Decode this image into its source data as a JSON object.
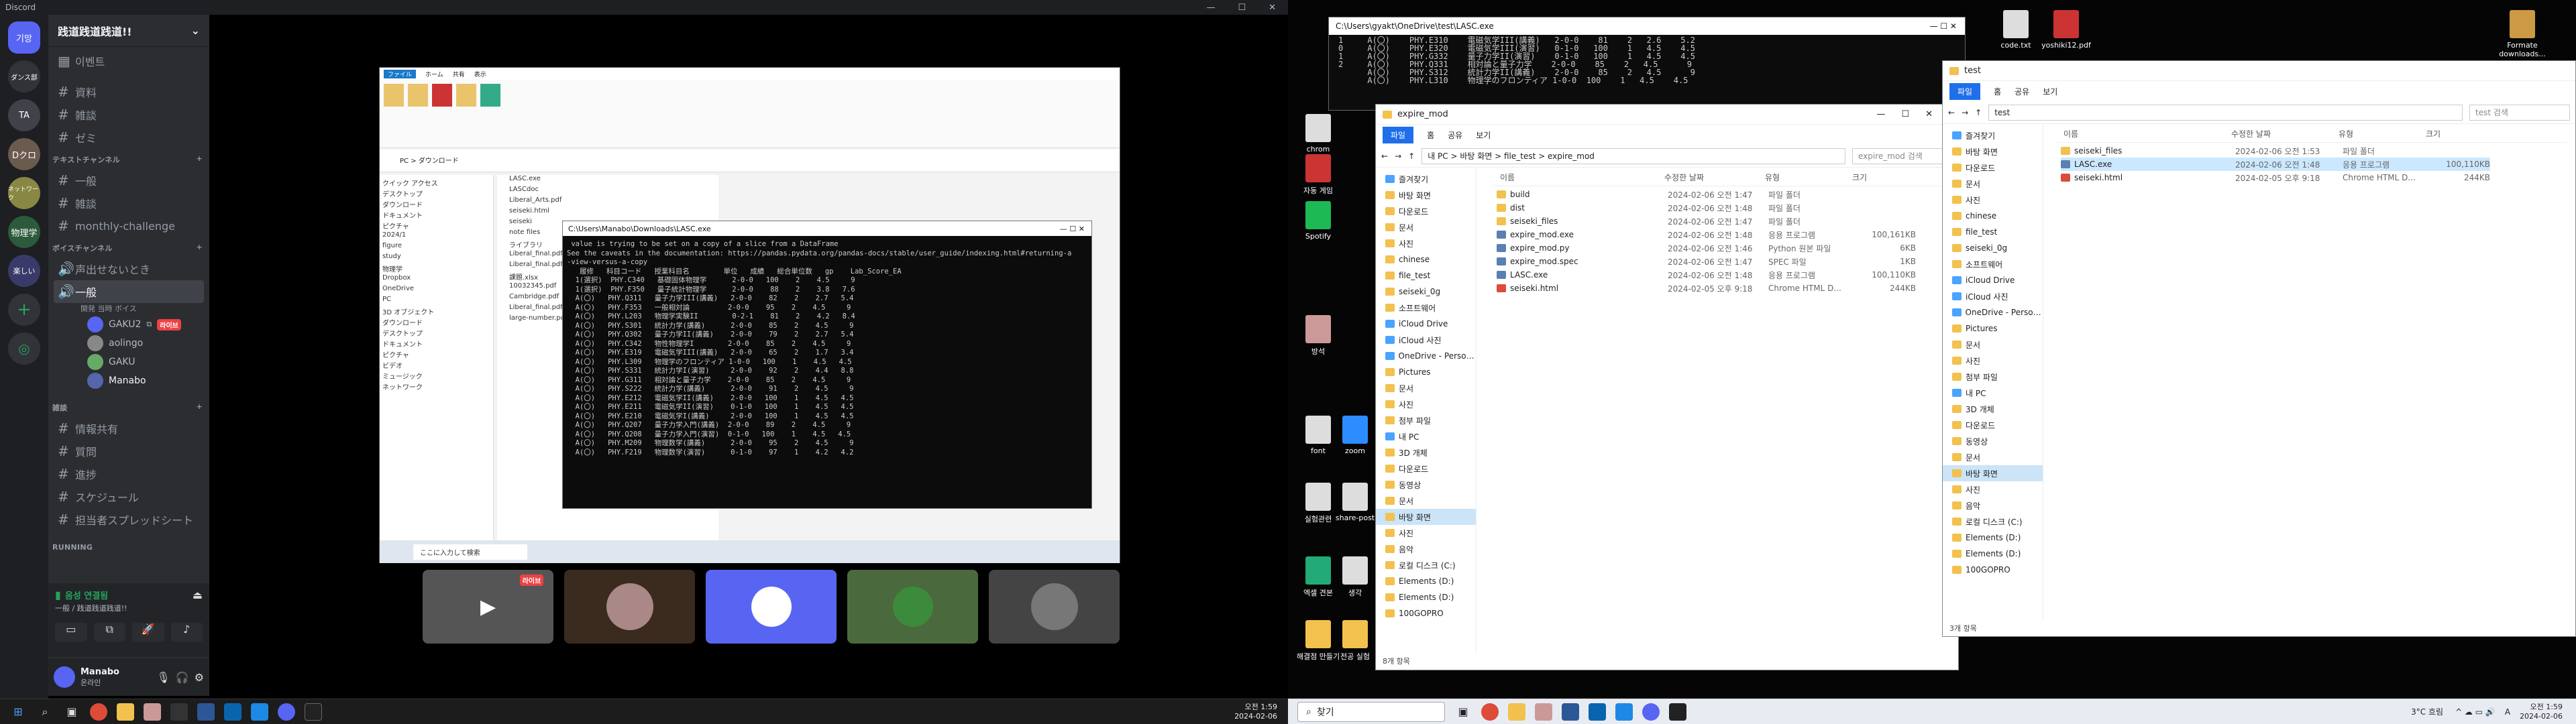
{
  "discord": {
    "app_title": "Discord",
    "server_name": "践道践道践道!!",
    "top_channels": [
      {
        "label": "이벤트"
      }
    ],
    "channels_a": [
      "資料",
      "雑談",
      "ゼミ"
    ],
    "cat_text": "テキストチャンネル",
    "channels_b": [
      "一般",
      "雑談",
      "monthly-challenge"
    ],
    "cat_voice": "ボイスチャンネル",
    "voice_channels": [
      "声出せないとき",
      "一般"
    ],
    "voice_sub": "開発 当時 ボイス",
    "voice_users": [
      {
        "name": "GAKU2",
        "live": "라이브"
      },
      {
        "name": "aolingo",
        "live": ""
      },
      {
        "name": "GAKU",
        "live": ""
      },
      {
        "name": "Manabo",
        "live": ""
      }
    ],
    "cat_misc": "雑談",
    "channels_c": [
      "情報共有",
      "質問",
      "進捗",
      "スケジュール",
      "担当者スプレッドシート"
    ],
    "cat_running": "RUNNING",
    "vc_status": "음성 연결됨",
    "vc_sub": "一般 / 践道践道践道!!",
    "user_name": "Manabo",
    "user_status": "온라인",
    "guild_labels": [
      "기망",
      "ダンス部",
      "TA",
      "Dクロ",
      "ネットワーク",
      "物理学",
      "楽しい"
    ],
    "tile_live": "라이브"
  },
  "stream": {
    "explorer_tabs": [
      "ファイル",
      "ホーム",
      "共有",
      "表示"
    ],
    "explorer_path": "PC > ダウンロード",
    "tree": [
      "クイック アクセス",
      "デスクトップ",
      "ダウンロード",
      "ドキュメント",
      "ピクチャ",
      "2024/1",
      "figure",
      "study",
      "物理学",
      "Dropbox",
      "OneDrive",
      "PC",
      "3D オブジェクト",
      "ダウンロード",
      "デスクトップ",
      "ドキュメント",
      "ピクチャ",
      "ビデオ",
      "ミュージック",
      "ネットワーク"
    ],
    "files": [
      "LASC.exe",
      "LASCdoc",
      "Liberal_Arts.pdf",
      "seiseki.html",
      "seiseki",
      "note files",
      "ライブラリ",
      "Liberal_final.pdf",
      "Liberal_final.pdf",
      "課題.xlsx",
      "10032345.pdf",
      "Cambridge.pdf",
      "Liberal_final.pdf",
      "large-number.pdf"
    ],
    "cmd_title": "C:\\Users\\Manabo\\Downloads\\LASC.exe",
    "cmd_lines": [
      " value is trying to be set on a copy of a slice from a DataFrame",
      "",
      "See the caveats in the documentation: https://pandas.pydata.org/pandas-docs/stable/user_guide/indexing.html#returning-a",
      "-view-versus-a-copy",
      "",
      "   履修   科目コード   授業科目名        単位   成績   総合単位数   gp    Lab_Score_EA",
      "  1(選択)  PHY.C340   基礎固体物理学      2-0-0   100    2    4.5     9",
      "  1(選択)  PHY.F350   量子統計物理学      2-0-0    88    2    3.8   7.6",
      "  A(〇)   PHY.Q311   量子力学III(講義)   2-0-0    82    2    2.7   5.4",
      "  A(〇)   PHY.F353   一般相対論         2-0-0    95    2    4.5     9",
      "  A(〇)   PHY.L203   物理学実験II        0-2-1    81    2    4.2   8.4",
      "  A(〇)   PHY.S301   統計力学(講義)      2-0-0    85    2    4.5     9",
      "  A(〇)   PHY.Q302   量子力学II(講義)    2-0-0    79    2    2.7   5.4",
      "  A(〇)   PHY.C342   物性物理学I        2-0-0    85    2    4.5     9",
      "  A(〇)   PHY.E319   電磁気学III(講義)   2-0-0    65    2    1.7   3.4",
      "  A(〇)   PHY.L309   物理学のフロンティア 1-0-0   100    1    4.5   4.5",
      "  A(〇)   PHY.S331   統計力学I(演習)     2-0-0    92    2    4.4   8.8",
      "  A(〇)   PHY.G311   相対論と量子力学    2-0-0    85    2    4.5     9",
      "  A(〇)   PHY.S222   統計力学(講義)      2-0-0    91    2    4.5     9",
      "  A(〇)   PHY.E212   電磁気学II(講義)    2-0-0   100    1    4.5   4.5",
      "  A(〇)   PHY.E211   電磁気学II(演習)    0-1-0   100    1    4.5   4.5",
      "  A(〇)   PHY.E210   電磁気学I(講義)     2-0-0   100    1    4.5   4.5",
      "  A(〇)   PHY.Q207   量子力学入門(講義)  2-0-0    89    2    4.5     9",
      "  A(〇)   PHY.Q208   量子力学入門(演習)  0-1-0   100    1    4.5   4.5",
      "  A(〇)   PHY.M209   物理数学(講義)      2-0-0    95    2    4.5     9",
      "  A(〇)   PHY.F219   物理数学(演習)      0-1-0    97    1    4.2   4.2"
    ],
    "search_text": "ここに入力して検索"
  },
  "right": {
    "cmd_title": "C:\\Users\\gyakt\\OneDrive\\test\\LASC.exe",
    "cmd_lines": [
      "1     A(〇)    PHY.E310    電磁気学III(講義)   2-0-0    81    2   2.6    5.2",
      "0     A(〇)    PHY.E320    電磁気学III(演習)   0-1-0   100    1   4.5    4.5",
      "1     A(〇)    PHY.G332    量子力学II(演習)    0-1-0   100    1   4.5    4.5",
      "2     A(〇)    PHY.Q331    相対論と量子力学    2-0-0    85    2   4.5      9",
      "      A(〇)    PHY.S312    統計力学II(講義)    2-0-0    85    2   4.5      9",
      "      A(〇)    PHY.L310    物理学のフロンティア 1-0-0  100    1   4.5    4.5"
    ],
    "desktop_icons": [
      "chrom",
      "자동 게임",
      "Spotify",
      "방석",
      "font",
      "zoom",
      "실험관련",
      "share-post",
      "엑셀 견본",
      "생각",
      "해결점 만들기",
      "전공 실험",
      "code.txt",
      "yoshiki12.pdf",
      "Formate downloads..."
    ],
    "exp1": {
      "title": "expire_mod",
      "tabs": [
        "파일",
        "홈",
        "공유",
        "보기"
      ],
      "path": "내 PC  >  바탕 화면  >  file_test  >  expire_mod",
      "search": "expire_mod 검색",
      "cols": [
        "이름",
        "수정한 날짜",
        "유형",
        "크기"
      ],
      "nav": [
        "즐겨찾기",
        "바탕 화면",
        "다운로드",
        "문서",
        "사진",
        "chinese",
        "file_test",
        "seiseki_0g",
        "소프트웨어",
        "iCloud Drive",
        "iCloud 사진",
        "OneDrive - Personal",
        "Pictures",
        "문서",
        "사진",
        "첨부 파일",
        "내 PC",
        "3D 개체",
        "다운로드",
        "동영상",
        "문서",
        "바탕 화면",
        "사진",
        "음악",
        "로컬 디스크 (C:)",
        "Elements (D:)",
        "Elements (D:)",
        "100GOPRO"
      ],
      "files": [
        [
          "build",
          "2024-02-06 오전 1:47",
          "파일 폴더",
          ""
        ],
        [
          "dist",
          "2024-02-06 오전 1:48",
          "파일 폴더",
          ""
        ],
        [
          "seiseki_files",
          "2024-02-06 오전 1:47",
          "파일 폴더",
          ""
        ],
        [
          "expire_mod.exe",
          "2024-02-06 오전 1:48",
          "응용 프로그램",
          "100,161KB"
        ],
        [
          "expire_mod.py",
          "2024-02-06 오전 1:46",
          "Python 원본 파일",
          "6KB"
        ],
        [
          "expire_mod.spec",
          "2024-02-06 오전 1:47",
          "SPEC 파일",
          "1KB"
        ],
        [
          "LASC.exe",
          "2024-02-06 오전 1:48",
          "응용 프로그램",
          "100,110KB"
        ],
        [
          "seiseki.html",
          "2024-02-05 오후 9:18",
          "Chrome HTML D...",
          "244KB"
        ]
      ],
      "status": "8개 항목"
    },
    "exp2": {
      "title": "test",
      "tabs": [
        "파일",
        "홈",
        "공유",
        "보기"
      ],
      "path": "test",
      "search": "test 검색",
      "cols": [
        "이름",
        "수정한 날짜",
        "유형",
        "크기"
      ],
      "nav": [
        "즐겨찾기",
        "바탕 화면",
        "다운로드",
        "문서",
        "사진",
        "chinese",
        "file_test",
        "seiseki_0g",
        "소프트웨어",
        "iCloud Drive",
        "iCloud 사진",
        "OneDrive - Personal",
        "Pictures",
        "문서",
        "사진",
        "첨부 파일",
        "내 PC",
        "3D 개체",
        "다운로드",
        "동영상",
        "문서",
        "바탕 화면",
        "사진",
        "음악",
        "로컬 디스크 (C:)",
        "Elements (D:)",
        "Elements (D:)",
        "100GOPRO"
      ],
      "files": [
        [
          "seiseki_files",
          "2024-02-06 오전 1:53",
          "파일 폴더",
          ""
        ],
        [
          "LASC.exe",
          "2024-02-06 오전 1:48",
          "응용 프로그램",
          "100,110KB"
        ],
        [
          "seiseki.html",
          "2024-02-05 오후 9:18",
          "Chrome HTML D...",
          "244KB"
        ]
      ],
      "status": "3개 항목"
    },
    "search": "찾기",
    "weather": "3°C 흐림",
    "lang": "A",
    "time": "오전 1:59",
    "date": "2024-02-06"
  },
  "left_taskbar": {
    "time": "오전 1:59",
    "date": "2024-02-06"
  },
  "colors": {
    "discord_bg": "#313338",
    "blurple": "#5865f2",
    "live_red": "#ed4245",
    "win_accent": "#1f6feb"
  }
}
